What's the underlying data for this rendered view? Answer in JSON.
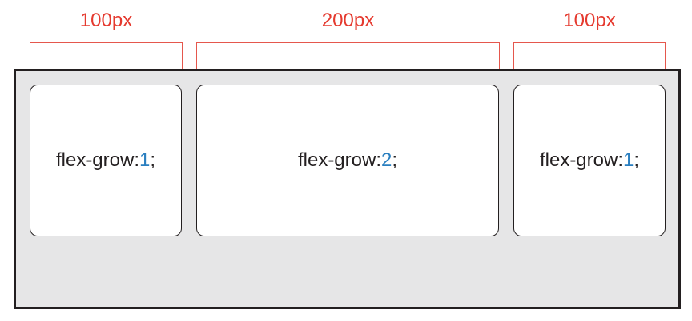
{
  "annotations": [
    {
      "label": "100px"
    },
    {
      "label": "200px"
    },
    {
      "label": "100px"
    }
  ],
  "items": [
    {
      "property": "flex-grow: ",
      "value": "1",
      "terminator": ";"
    },
    {
      "property": "flex-grow: ",
      "value": "2",
      "terminator": ";"
    },
    {
      "property": "flex-grow: ",
      "value": "1",
      "terminator": ";"
    }
  ],
  "colors": {
    "annotation": "#e53a2f",
    "container_border": "#231f20",
    "container_fill": "#e6e6e7",
    "item_fill": "#ffffff",
    "value_text": "#2a7fc0"
  }
}
